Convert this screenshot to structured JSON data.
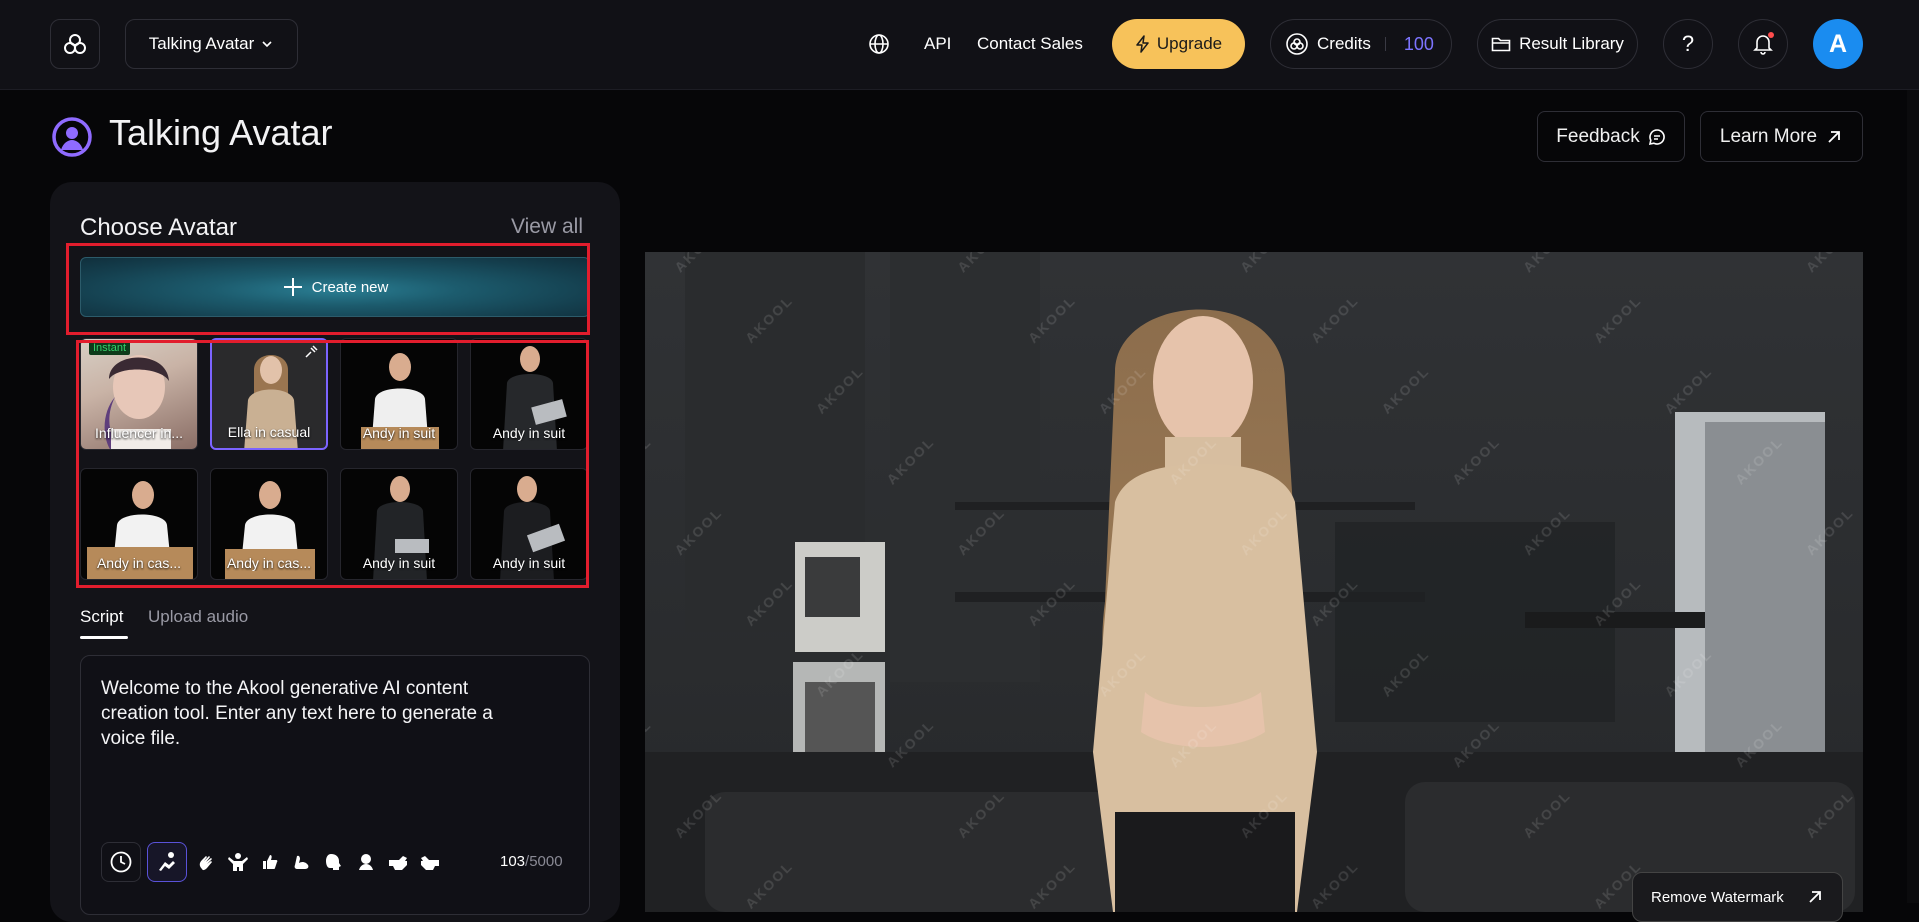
{
  "header": {
    "product": "Talking Avatar",
    "nav": {
      "api": "API",
      "contact": "Contact Sales"
    },
    "upgrade": "Upgrade",
    "credits": {
      "label": "Credits",
      "value": "100"
    },
    "library": "Result Library",
    "help": "?",
    "avatar_initial": "A"
  },
  "page": {
    "title": "Talking Avatar",
    "feedback": "Feedback",
    "learn_more": "Learn More"
  },
  "panel": {
    "title": "Choose Avatar",
    "view_all": "View all",
    "create_new": "Create new",
    "avatars": [
      {
        "label": "Influencer in...",
        "badge": "Instant"
      },
      {
        "label": "Ella in casual"
      },
      {
        "label": "Andy in suit"
      },
      {
        "label": "Andy in suit"
      },
      {
        "label": "Andy in cas..."
      },
      {
        "label": "Andy in cas..."
      },
      {
        "label": "Andy in suit"
      },
      {
        "label": "Andy in suit"
      }
    ],
    "tabs": {
      "script": "Script",
      "upload": "Upload audio"
    },
    "script_text": "Welcome to the Akool generative AI content creation tool. Enter any text here to generate a voice file.",
    "counter": {
      "current": "103",
      "max": "/5000"
    }
  },
  "preview": {
    "watermark": "AKOOL",
    "remove_watermark": "Remove Watermark"
  },
  "colors": {
    "accent": "#7c64ff",
    "upgrade": "#f7c25a",
    "credits_value": "#7d74ff",
    "avatar": "#1a8cf0",
    "highlight": "#e21d2d"
  }
}
